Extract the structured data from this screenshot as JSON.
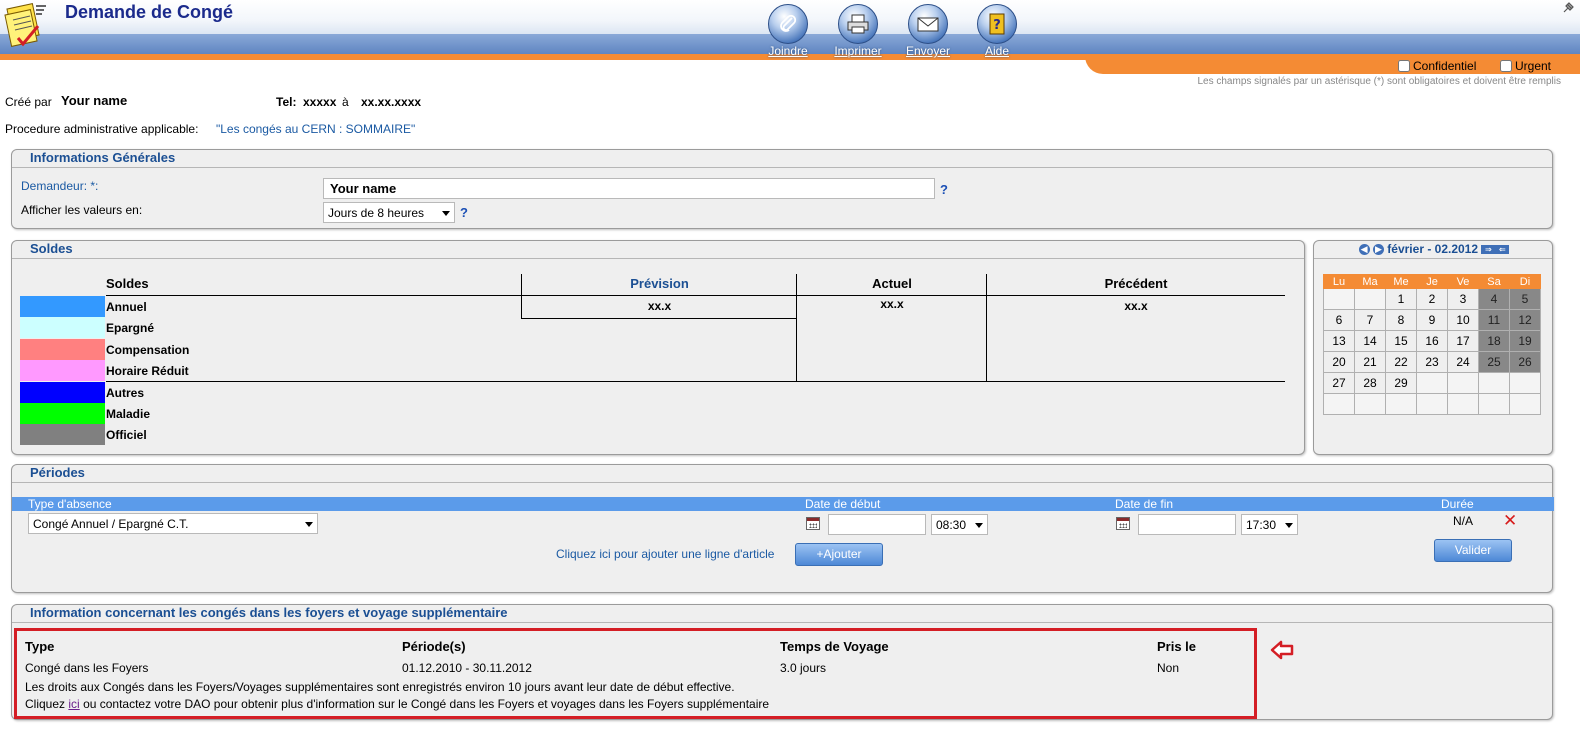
{
  "header": {
    "title": "Demande de Congé",
    "tools": [
      {
        "label": "Joindre",
        "icon": "paperclip-icon"
      },
      {
        "label": "Imprimer",
        "icon": "printer-icon"
      },
      {
        "label": "Envoyer",
        "icon": "envelope-icon"
      },
      {
        "label": "Aide",
        "icon": "help-book-icon"
      }
    ],
    "confidentiel_label": "Confidentiel",
    "urgent_label": "Urgent",
    "mandatory_note": "Les champs signalés par un astérisque (*) sont obligatoires et doivent être remplis",
    "accent_color": "#f48b34",
    "band_color": "#6b8ec9"
  },
  "meta": {
    "created_by_label": "Créé par",
    "created_by_name": "Your name",
    "tel_label": "Tel:",
    "tel_number": "xxxxx",
    "tel_a": "à",
    "tel_ext": "xx.xx.xxxx",
    "procedure_label": "Procedure administrative applicable:",
    "procedure_link": "\"Les congés au CERN : SOMMAIRE\""
  },
  "general": {
    "title": "Informations Générales",
    "demandeur_label": "Demandeur: *:",
    "demandeur_value": "Your name",
    "afficher_label": "Afficher les valeurs en:",
    "afficher_value": "Jours de 8 heures",
    "help": "?"
  },
  "soldes": {
    "title": "Soldes",
    "headers": {
      "soldes": "Soldes",
      "prevision": "Prévision",
      "actuel": "Actuel",
      "precedent": "Précédent"
    },
    "values": {
      "prevision": "xx.x",
      "actuel": "xx.x",
      "precedent": "xx.x"
    },
    "legend": [
      {
        "label": "Annuel",
        "color": "#3399ff"
      },
      {
        "label": "Epargné",
        "color": "#ccffff"
      },
      {
        "label": "Compensation",
        "color": "#ff8080"
      },
      {
        "label": "Horaire Réduit",
        "color": "#ff99ff"
      },
      {
        "label": "Autres",
        "color": "#0000ff"
      },
      {
        "label": "Maladie",
        "color": "#00ff00"
      },
      {
        "label": "Officiel",
        "color": "#808080"
      }
    ]
  },
  "calendar": {
    "month_label": "février - 02.2012",
    "weekdays": [
      "Lu",
      "Ma",
      "Me",
      "Je",
      "Ve",
      "Sa",
      "Di"
    ],
    "weeks": [
      [
        "",
        "",
        "1",
        "2",
        "3",
        "4",
        "5"
      ],
      [
        "6",
        "7",
        "8",
        "9",
        "10",
        "11",
        "12"
      ],
      [
        "13",
        "14",
        "15",
        "16",
        "17",
        "18",
        "19"
      ],
      [
        "20",
        "21",
        "22",
        "23",
        "24",
        "25",
        "26"
      ],
      [
        "27",
        "28",
        "29",
        "",
        "",
        "",
        ""
      ],
      [
        "",
        "",
        "",
        "",
        "",
        "",
        ""
      ]
    ]
  },
  "periodes": {
    "title": "Périodes",
    "headers": {
      "type": "Type d'absence",
      "debut": "Date de début",
      "fin": "Date de fin",
      "duree": "Durée"
    },
    "type_value": "Congé Annuel / Epargné C.T.",
    "date_debut": "",
    "time_debut": "08:30",
    "date_fin": "",
    "time_fin": "17:30",
    "duree": "N/A",
    "add_line_text": "Cliquez ici pour ajouter une ligne d'article",
    "add_button": "+Ajouter",
    "validate_button": "Valider"
  },
  "foyers": {
    "title": "Information concernant les congés dans les foyers et voyage supplémentaire",
    "headers": {
      "type": "Type",
      "periode": "Période(s)",
      "temps": "Temps de Voyage",
      "pris": "Pris le"
    },
    "row": {
      "type": "Congé dans les Foyers",
      "periode": "01.12.2010 - 30.11.2012",
      "temps": "3.0 jours",
      "pris": "Non"
    },
    "note1": "Les droits aux Congés dans les Foyers/Voyages supplémentaires sont enregistrés environ 10 jours avant leur date de début effective.",
    "note2_before": "Cliquez",
    "note2_link": "ici",
    "note2_after": "ou contactez votre DAO pour obtenir plus d'information sur le Congé dans les Foyers et voyages dans les Foyers supplémentaire",
    "highlight_color": "#d41e25"
  }
}
